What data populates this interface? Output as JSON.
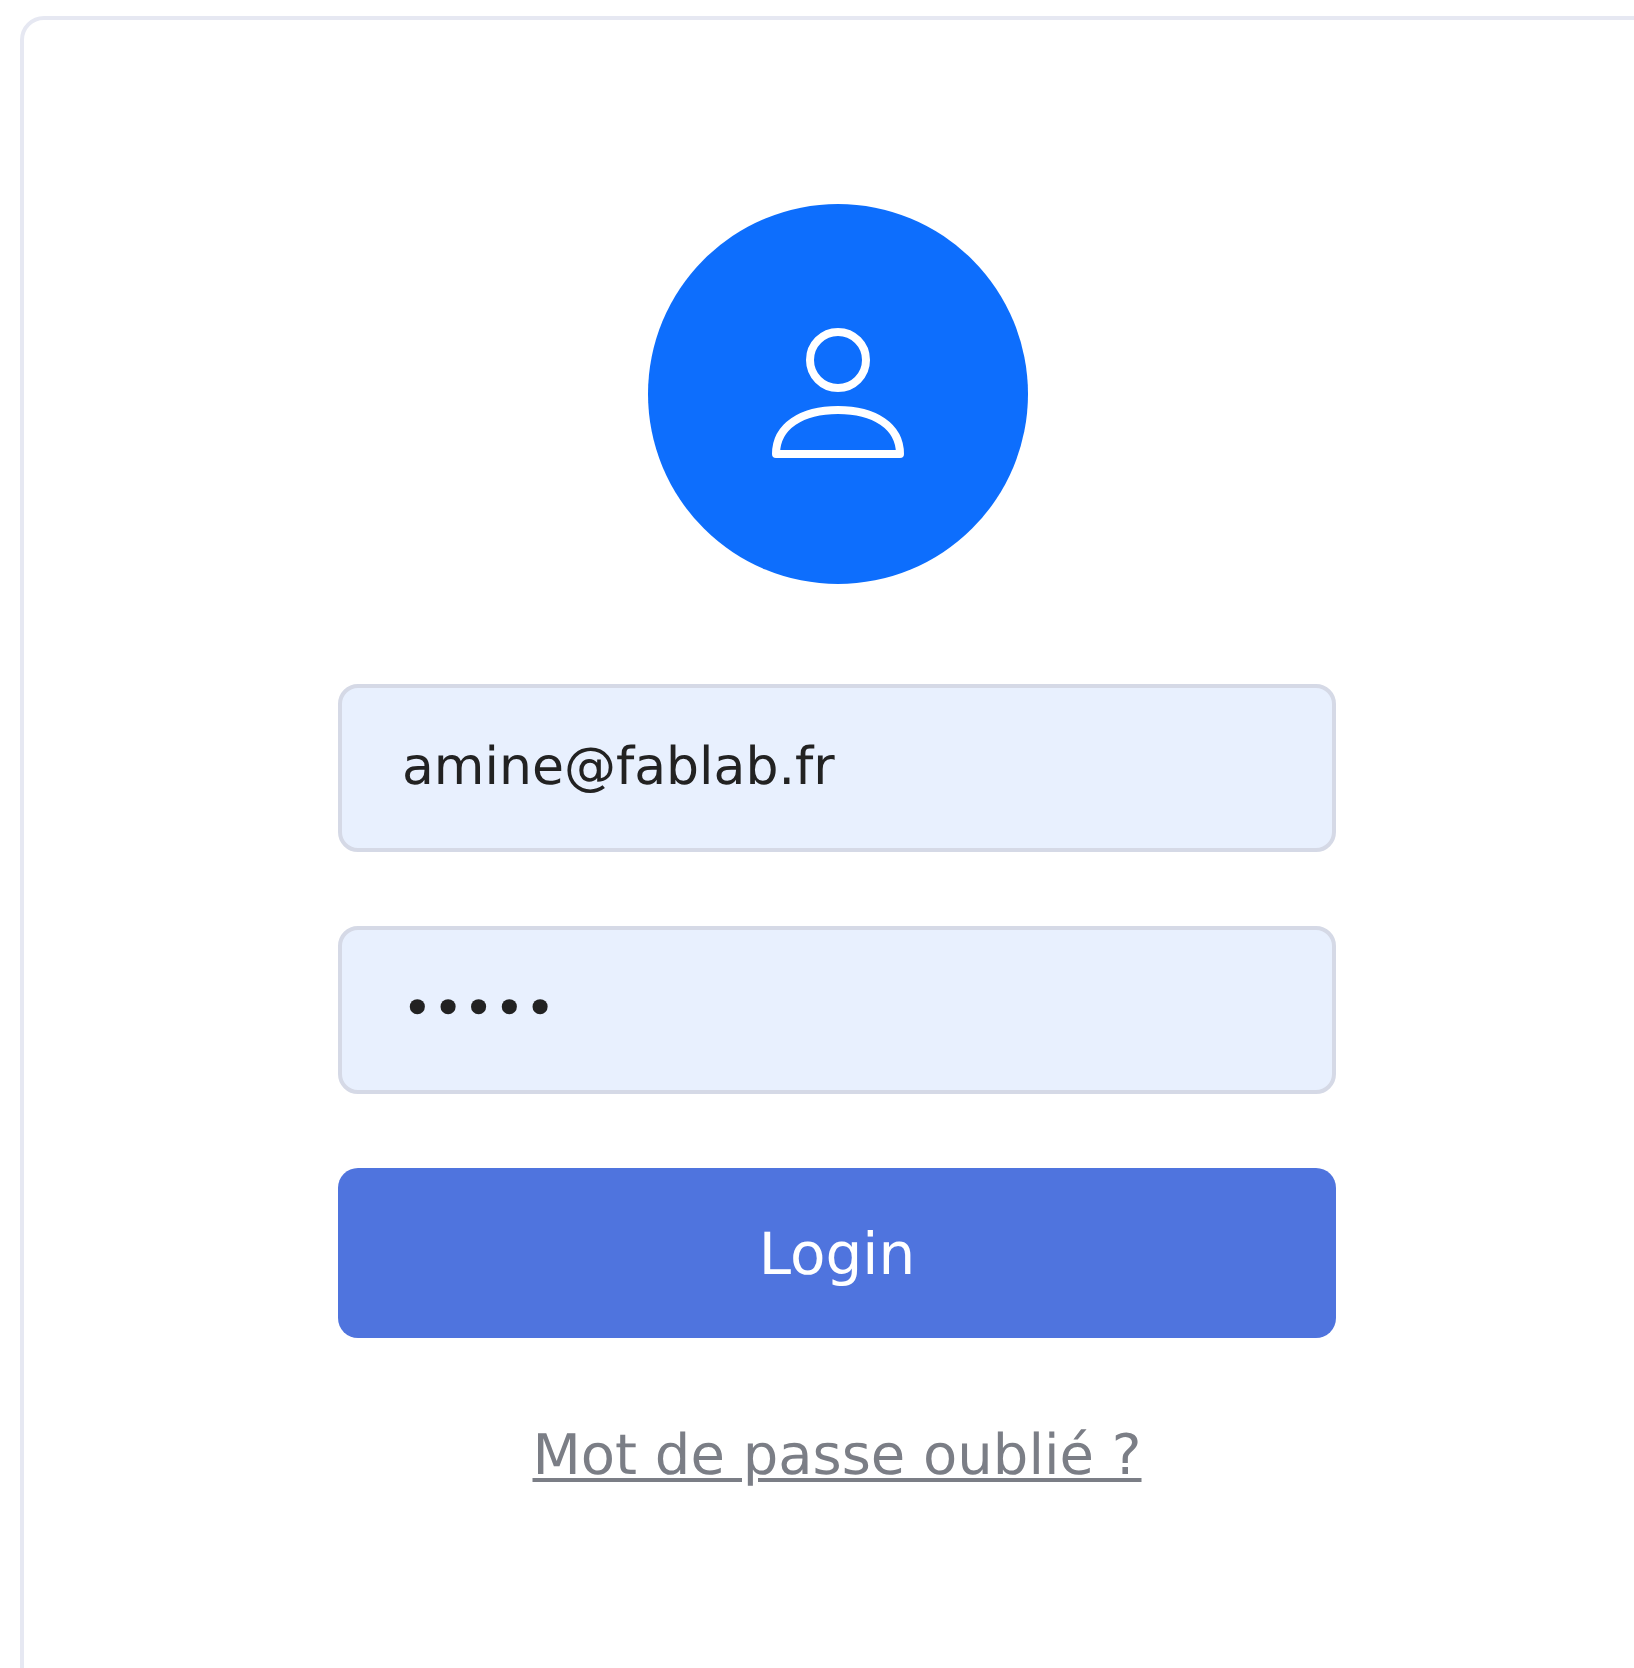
{
  "email_field": {
    "value": "amine@fablab.fr"
  },
  "password_field": {
    "value": "•••••"
  },
  "login_button": {
    "label": "Login"
  },
  "forgot_link": {
    "label": "Mot de passe oublié ?"
  }
}
